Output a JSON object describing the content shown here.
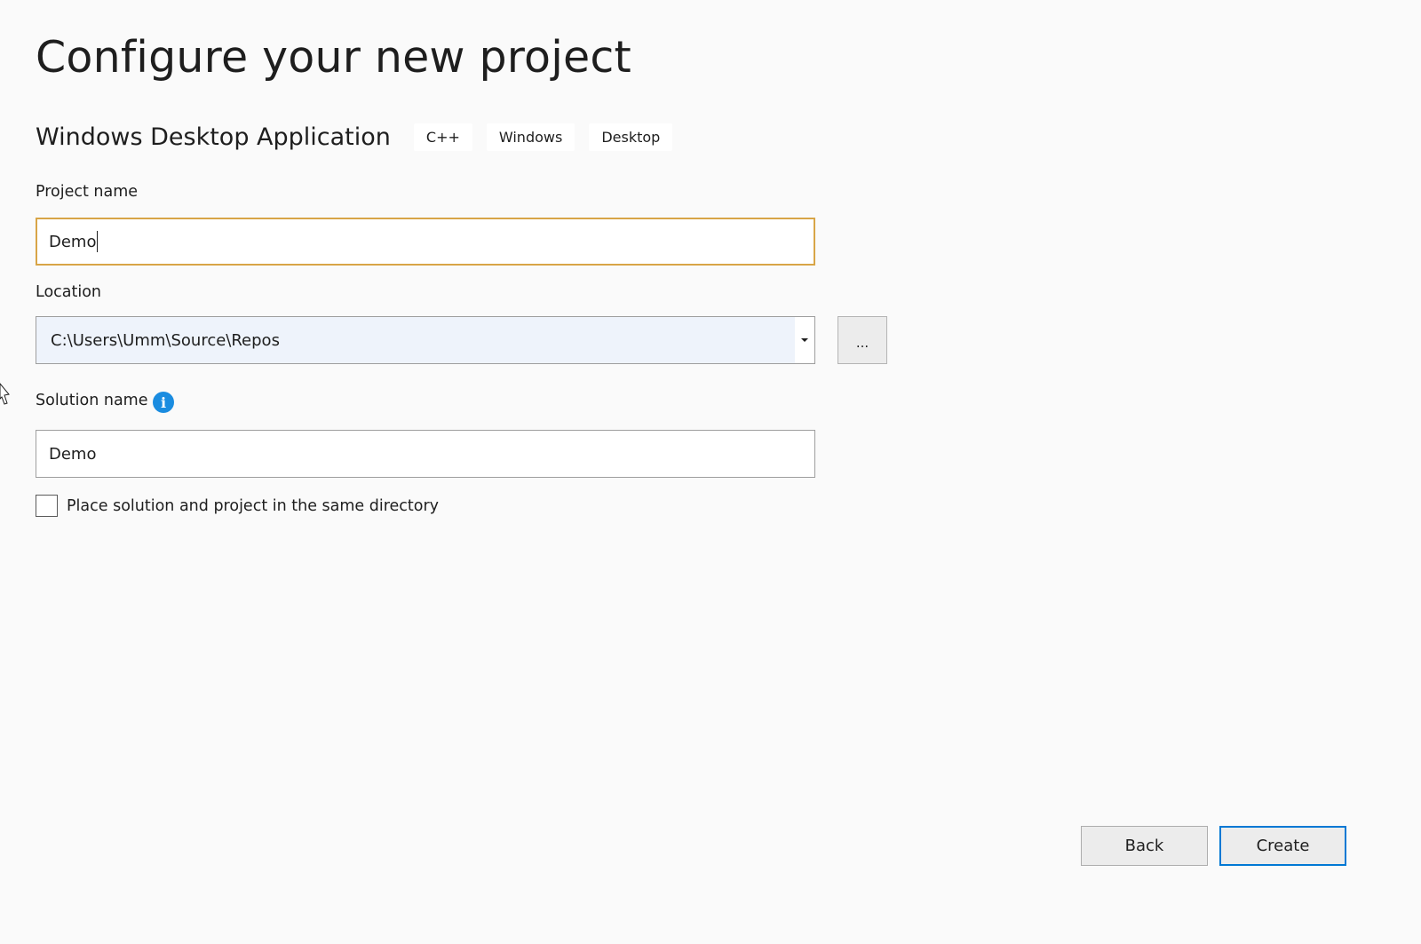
{
  "page": {
    "title": "Configure your new project"
  },
  "template": {
    "name": "Windows Desktop Application",
    "tags": [
      "C++",
      "Windows",
      "Desktop"
    ]
  },
  "project_name": {
    "label": "Project name",
    "value": "Demo"
  },
  "location": {
    "label": "Location",
    "value": "C:\\Users\\Umm\\Source\\Repos",
    "browse_label": "..."
  },
  "solution_name": {
    "label": "Solution name",
    "value": "Demo",
    "info_icon": "info-icon"
  },
  "same_directory": {
    "label": "Place solution and project in the same directory",
    "checked": false
  },
  "buttons": {
    "back": "Back",
    "create": "Create"
  },
  "colors": {
    "background": "#fafafa",
    "focus_border": "#d8a547",
    "primary_border": "#0078d4",
    "info_icon": "#1a8ce0",
    "combo_background": "#eef3fb"
  }
}
